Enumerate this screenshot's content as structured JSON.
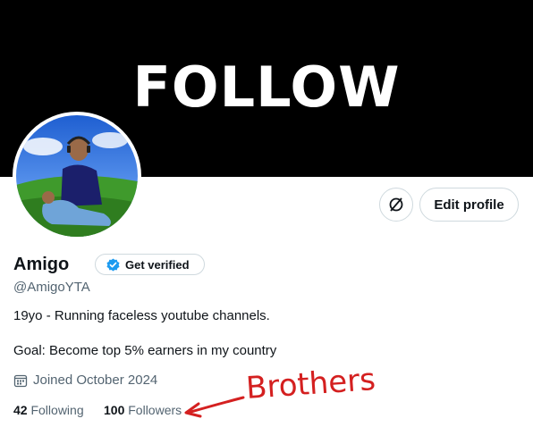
{
  "banner": {
    "text": "FOLLOW"
  },
  "profile": {
    "name": "Amigo",
    "handle": "@AmigoYTA",
    "bio_line1": "19yo - Running faceless youtube channels.",
    "bio_line2": "Goal: Become top 5% earners in my country",
    "joined": "Joined October 2024"
  },
  "actions": {
    "edit_profile": "Edit profile",
    "get_verified": "Get verified",
    "analytics_icon": "no-analytics-icon"
  },
  "stats": {
    "following_count": "42",
    "following_label": "Following",
    "followers_count": "100",
    "followers_label": "Followers"
  },
  "annotation": {
    "text": "Brothers",
    "color": "#d42020"
  },
  "colors": {
    "verified_blue": "#1d9bf0",
    "muted": "#536471",
    "border": "#cfd9de"
  }
}
